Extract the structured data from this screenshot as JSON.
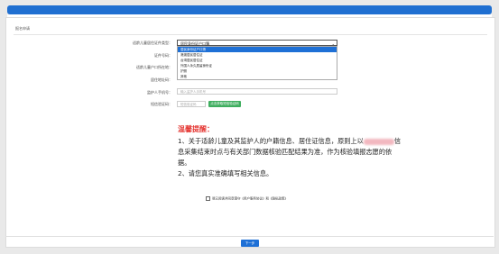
{
  "section_title": "报名申请",
  "form": {
    "relationship_label": "适龄儿童居住证件类型：",
    "cert_no_label": "证件号码：",
    "child_hukou_label": "适龄儿童户口所在地：",
    "id_label": "居住地址码：",
    "guardian_label": "监护人手机号：",
    "verify_label": "短信验证码：",
    "selected_option": "居民身份证户口簿",
    "options": [
      "居民身份证户口簿",
      "港澳居民居住证",
      "台湾居民居住证",
      "外国人永久居留身份证",
      "护照",
      "其他"
    ],
    "guardian_placeholder": "输入监护人手机号",
    "verify_placeholder": "短信验证码",
    "send_code_label": "点击获取短信验证码"
  },
  "tips": {
    "title": "温馨提醒：",
    "line1_a": "1、关于适龄儿童及其监护人的户籍信息、居住证信息，原则上以",
    "line1_b": "信",
    "line2": "息采集结束时点与有关部门数据核验匹配结果为准，作为核验填报志愿的依",
    "line3": "据。",
    "line4": "2、请您真实准确填写相关信息。"
  },
  "agreement": "我已阅读并同意遵守《用户服务协议》和《隐私政策》",
  "next_label": "下一步"
}
